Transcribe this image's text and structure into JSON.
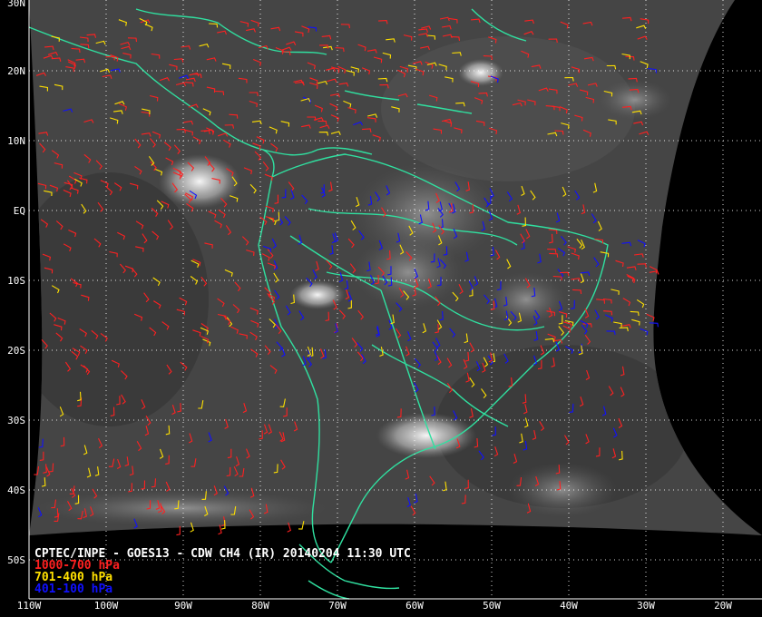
{
  "title": "CPTEC/INPE - GOES13 - CDW CH4 (IR) 20140204 11:30 UTC",
  "legend": [
    {
      "label": "1000-700 hPa",
      "color": "#ff2020"
    },
    {
      "label": "701-400 hPa",
      "color": "#ffe000"
    },
    {
      "label": "401-100 hPa",
      "color": "#1010ff"
    }
  ],
  "colors": {
    "background": "#000000",
    "coastline": "#30e0a0",
    "grid": "#ffffff",
    "cloud_gray": "#4a4a4a"
  },
  "lat_labels": [
    "30N",
    "20N",
    "10N",
    "EQ",
    "10S",
    "20S",
    "30S",
    "40S",
    "50S"
  ],
  "lon_labels": [
    "110W",
    "100W",
    "90W",
    "80W",
    "70W",
    "60W",
    "50W",
    "40W",
    "30W",
    "20W"
  ]
}
